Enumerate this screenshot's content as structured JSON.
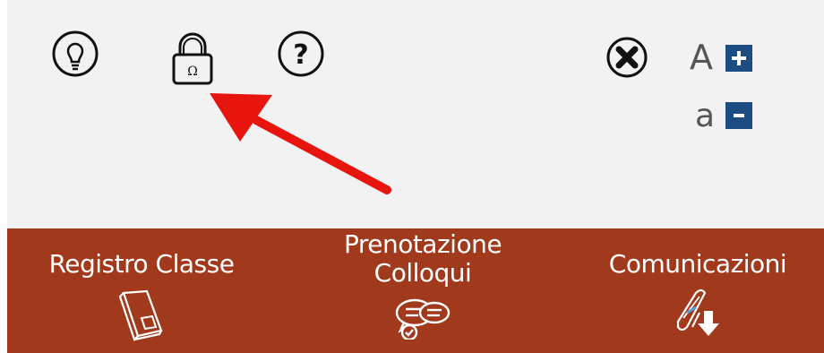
{
  "toolbar": {
    "icons": [
      "lightbulb-icon",
      "lock-icon",
      "help-icon",
      "close-circle-icon"
    ]
  },
  "font_size": {
    "increase_letter": "A",
    "decrease_letter": "a",
    "plus": "+",
    "minus": "-"
  },
  "nav": {
    "registro": "Registro Classe",
    "prenotazione_1": "Prenotazione",
    "prenotazione_2": "Colloqui",
    "comunicazioni": "Comunicazioni"
  },
  "colors": {
    "toolbar_bg": "#f2f2f2",
    "nav_bg": "#a1391c",
    "font_button": "#1d4c82",
    "annotation_arrow": "#e8150f"
  }
}
